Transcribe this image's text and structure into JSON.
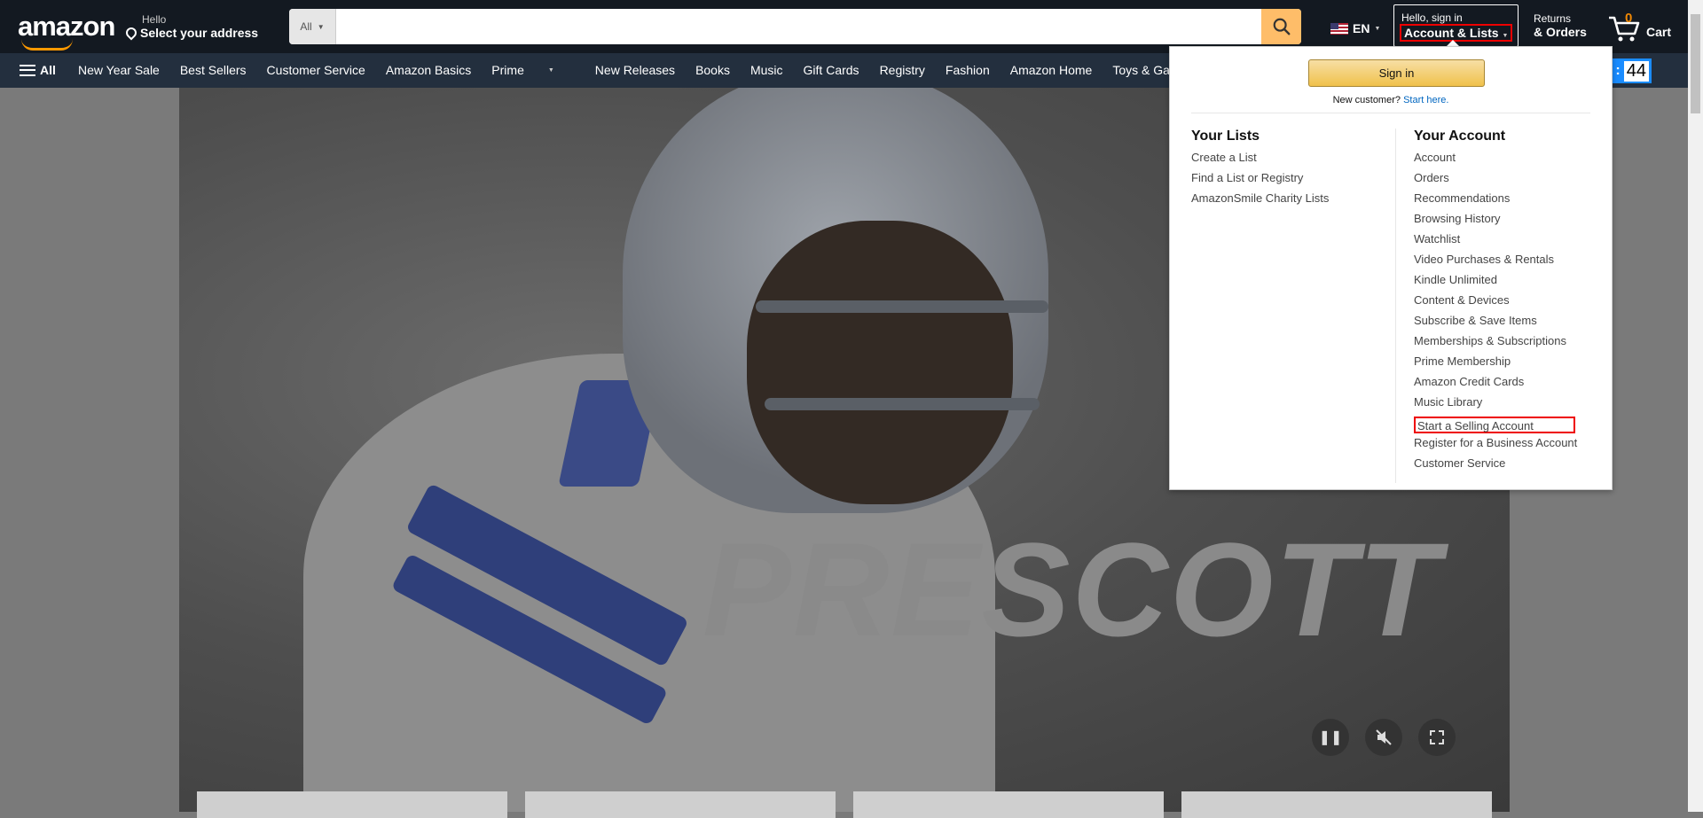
{
  "header": {
    "logo": "amazon",
    "address_hello": "Hello",
    "address_select": "Select your address",
    "search_category": "All",
    "search_placeholder": "",
    "lang": "EN",
    "account_hello": "Hello, sign in",
    "account_lists": "Account & Lists",
    "returns_line1": "Returns",
    "returns_line2": "& Orders",
    "cart_count": "0",
    "cart_label": "Cart"
  },
  "nav": {
    "all_label": "All",
    "items": [
      "New Year Sale",
      "Best Sellers",
      "Customer Service",
      "Amazon Basics",
      "Prime",
      "New Releases",
      "Books",
      "Music",
      "Gift Cards",
      "Registry",
      "Fashion",
      "Amazon Home",
      "Toys & Games"
    ],
    "timer_value": "44"
  },
  "hero": {
    "overlay_text": "PRESCOTT"
  },
  "dropdown": {
    "signin_button": "Sign in",
    "new_customer": "New customer?",
    "start_here": "Start here.",
    "lists": {
      "title": "Your Lists",
      "items": [
        "Create a List",
        "Find a List or Registry",
        "AmazonSmile Charity Lists"
      ]
    },
    "account": {
      "title": "Your Account",
      "items": [
        "Account",
        "Orders",
        "Recommendations",
        "Browsing History",
        "Watchlist",
        "Video Purchases & Rentals",
        "Kindle Unlimited",
        "Content & Devices",
        "Subscribe & Save Items",
        "Memberships & Subscriptions",
        "Prime Membership",
        "Amazon Credit Cards",
        "Music Library",
        "Start a Selling Account",
        "Register for a Business Account",
        "Customer Service"
      ]
    }
  },
  "colors": {
    "topbar": "#131921",
    "navbar": "#232f3e",
    "search_button": "#febd69",
    "accent": "#ff9900",
    "highlight": "#e00000"
  }
}
